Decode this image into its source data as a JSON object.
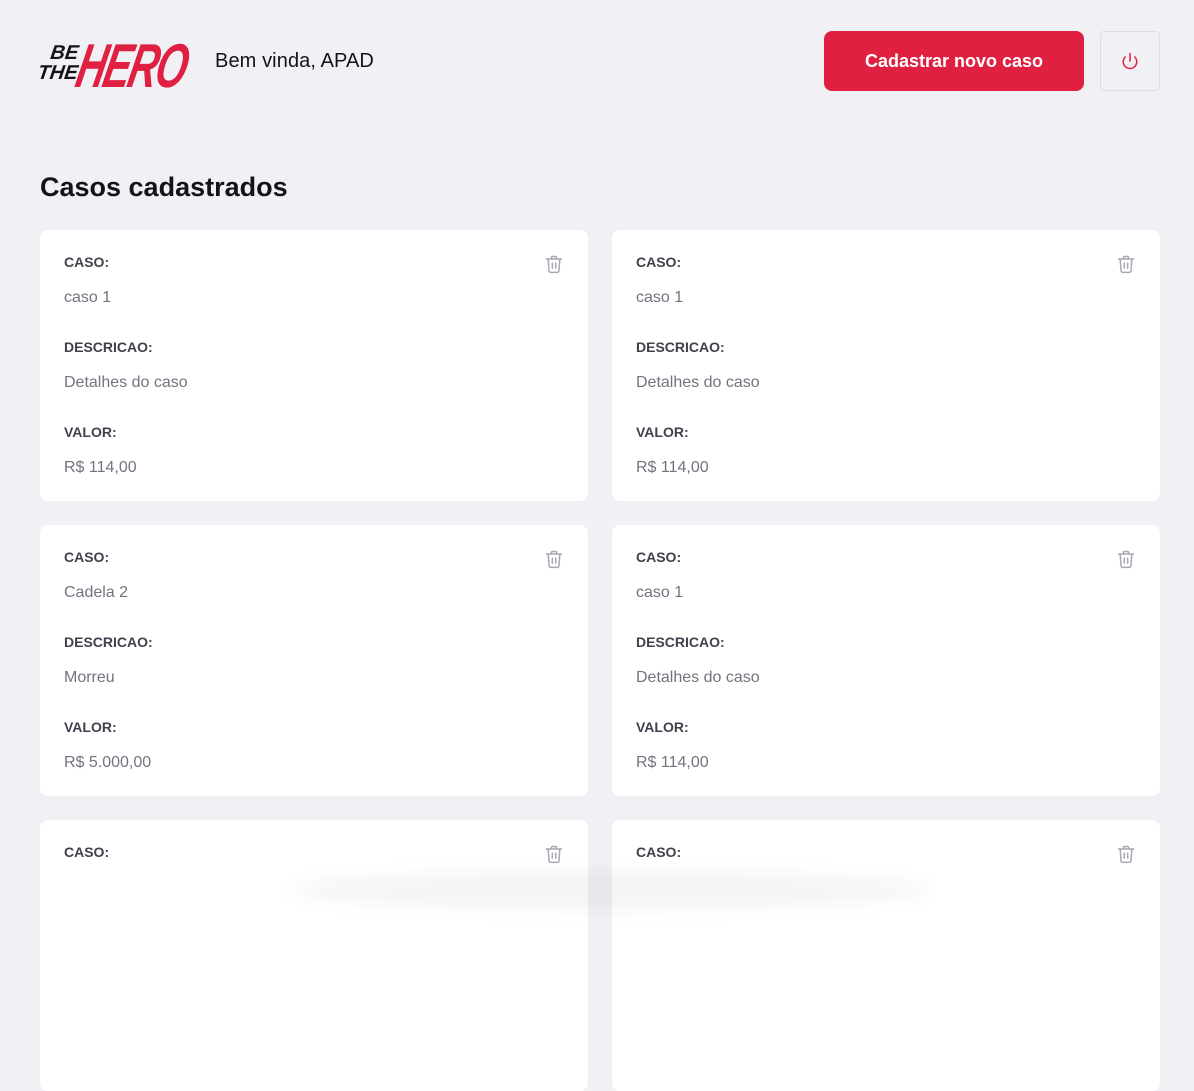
{
  "header": {
    "logo_text_small_1": "BE",
    "logo_text_small_2": "THE",
    "logo_text_big": "HERO",
    "greeting": "Bem vinda, APAD",
    "new_case_label": "Cadastrar novo caso",
    "logout_icon": "power-icon"
  },
  "colors": {
    "brand": "#e02041",
    "background": "#f0f0f5",
    "label": "#41414d",
    "value": "#737380"
  },
  "page": {
    "title": "Casos cadastrados"
  },
  "cases": [
    {
      "case_label": "CASO:",
      "case": "caso 1",
      "description_label": "DESCRICAO:",
      "description": "Detalhes do caso",
      "value_label": "VALOR:",
      "value": "R$ 114,00",
      "delete_icon": "trash-icon"
    },
    {
      "case_label": "CASO:",
      "case": "caso 1",
      "description_label": "DESCRICAO:",
      "description": "Detalhes do caso",
      "value_label": "VALOR:",
      "value": "R$ 114,00",
      "delete_icon": "trash-icon"
    },
    {
      "case_label": "CASO:",
      "case": "Cadela 2",
      "description_label": "DESCRICAO:",
      "description": "Morreu",
      "value_label": "VALOR:",
      "value": "R$ 5.000,00",
      "delete_icon": "trash-icon"
    },
    {
      "case_label": "CASO:",
      "case": "caso 1",
      "description_label": "DESCRICAO:",
      "description": "Detalhes do caso",
      "value_label": "VALOR:",
      "value": "R$ 114,00",
      "delete_icon": "trash-icon"
    },
    {
      "case_label": "CASO:",
      "case": "",
      "description_label": "",
      "description": "",
      "value_label": "",
      "value": "",
      "delete_icon": "trash-icon"
    },
    {
      "case_label": "CASO:",
      "case": "",
      "description_label": "",
      "description": "",
      "value_label": "",
      "value": "",
      "delete_icon": "trash-icon"
    }
  ]
}
